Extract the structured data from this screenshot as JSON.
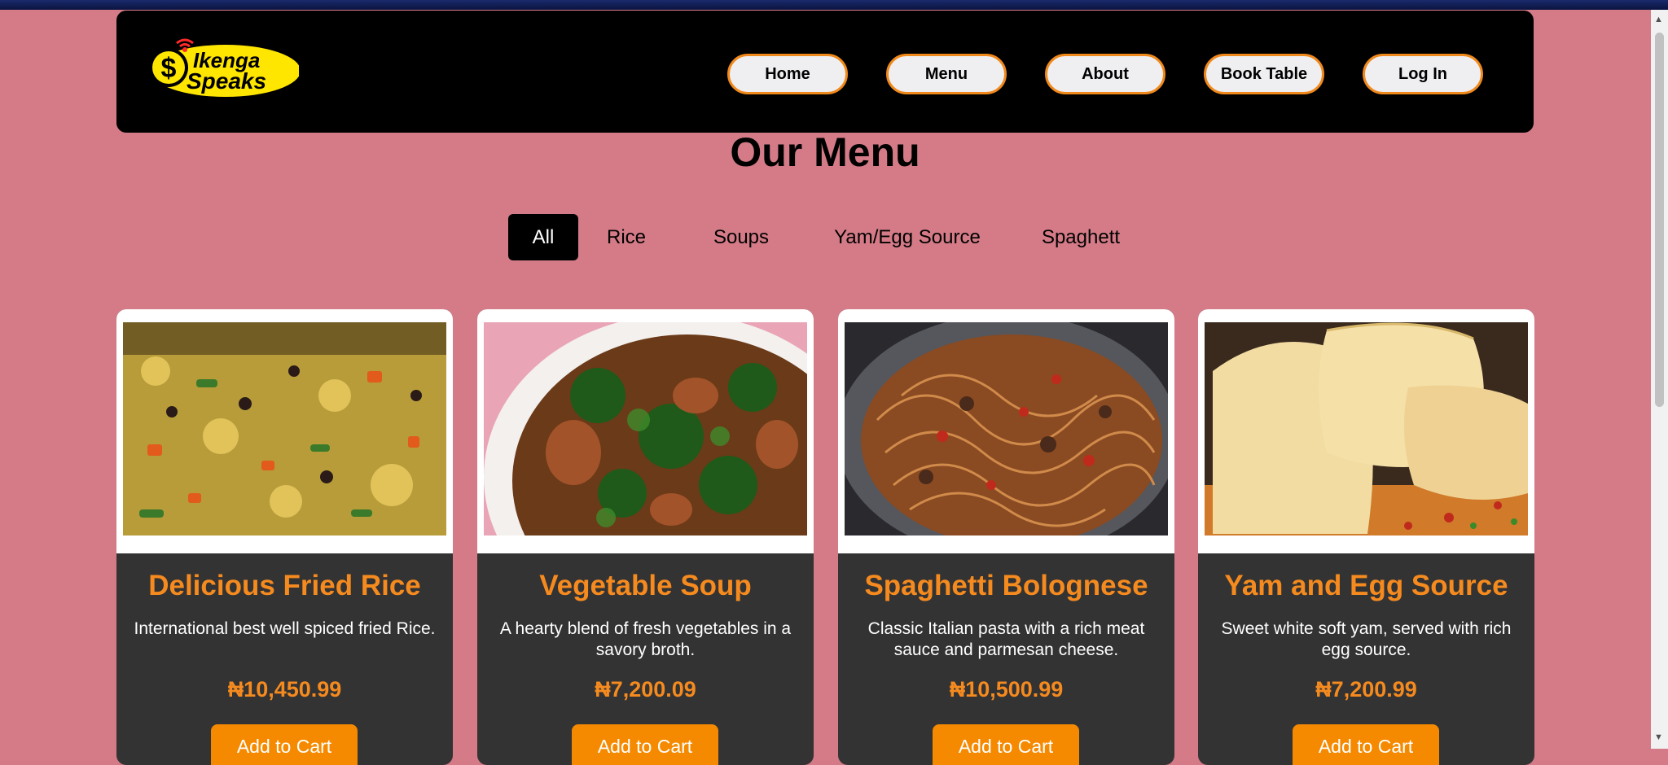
{
  "brand": {
    "logo_line1": "Ikenga",
    "logo_line2": "Speaks"
  },
  "nav": [
    "Home",
    "Menu",
    "About",
    "Book Table",
    "Log In"
  ],
  "page_title": "Our Menu",
  "filters": [
    "All",
    "Rice",
    "Soups",
    "Yam/Egg Source",
    "Spaghett"
  ],
  "active_filter": "All",
  "cards": [
    {
      "title": "Delicious Fried Rice",
      "desc": "International best well spiced fried Rice.",
      "price": "₦10,450.99",
      "button": "Add to Cart"
    },
    {
      "title": "Vegetable Soup",
      "desc": "A hearty blend of fresh vegetables in a savory broth.",
      "price": "₦7,200.09",
      "button": "Add to Cart"
    },
    {
      "title": "Spaghetti Bolognese",
      "desc": "Classic Italian pasta with a rich meat sauce and parmesan cheese.",
      "price": "₦10,500.99",
      "button": "Add to Cart"
    },
    {
      "title": "Yam and Egg Source",
      "desc": "Sweet white soft yam, served with rich egg source.",
      "price": "₦7,200.99",
      "button": "Add to Cart"
    }
  ],
  "colors": {
    "background": "#d47b87",
    "accent": "#f58a1f",
    "navbar": "#000000",
    "card": "#333333"
  }
}
